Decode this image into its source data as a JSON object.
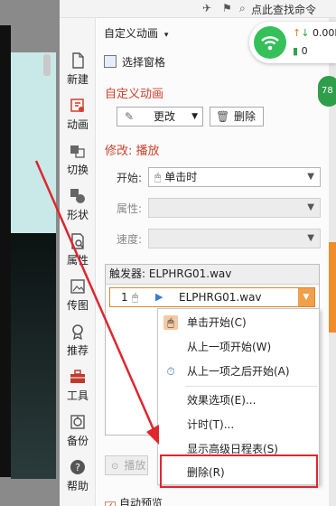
{
  "topbar": {
    "search_label": "点此查找命令"
  },
  "rail": [
    {
      "label": "新建",
      "icon": "new-file-icon"
    },
    {
      "label": "动画",
      "icon": "animation-icon"
    },
    {
      "label": "切换",
      "icon": "transition-icon"
    },
    {
      "label": "形状",
      "icon": "shape-icon"
    },
    {
      "label": "属性",
      "icon": "properties-icon"
    },
    {
      "label": "传图",
      "icon": "upload-image-icon"
    },
    {
      "label": "推荐",
      "icon": "recommend-icon"
    },
    {
      "label": "工具",
      "icon": "toolbox-icon"
    },
    {
      "label": "备份",
      "icon": "backup-icon"
    },
    {
      "label": "帮助",
      "icon": "help-icon"
    }
  ],
  "pane": {
    "header": "自定义动画",
    "select_pane": "选择窗格",
    "section_custom": "自定义动画",
    "change_label": "更改",
    "delete_label": "删除",
    "modify_title": "修改: 播放",
    "start_label": "开始:",
    "start_value": "单击时",
    "property_label": "属性:",
    "speed_label": "速度:",
    "trigger_header": "触发器: ELPHRG01.wav",
    "trigger_row": {
      "index": "1",
      "name": "ELPHRG01.wav"
    },
    "play_label": "播放",
    "auto_preview": "自动预览"
  },
  "network": {
    "upload": "0.00K/",
    "download": "0"
  },
  "badge": "78",
  "menu": [
    "单击开始(C)",
    "从上一项开始(W)",
    "从上一项之后开始(A)",
    "效果选项(E)...",
    "计时(T)...",
    "显示高级日程表(S)",
    "删除(R)"
  ],
  "colors": {
    "accent_red": "#d0402b",
    "highlight_red": "#e0262e",
    "orange": "#f08c2a",
    "wifi_green": "#35c05a"
  }
}
